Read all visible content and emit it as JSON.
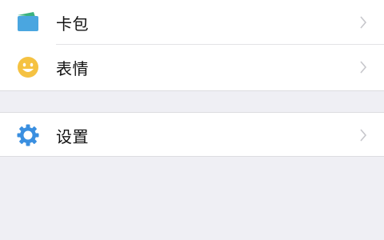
{
  "menu": {
    "items": [
      {
        "label": "卡包",
        "icon": "card-wallet-icon"
      },
      {
        "label": "表情",
        "icon": "emoji-smile-icon"
      }
    ],
    "settings": {
      "label": "设置",
      "icon": "gear-icon"
    }
  },
  "colors": {
    "background": "#efeff4",
    "card_icon": "#4aa6e0",
    "card_tab": "#3bb27f",
    "emoji_icon": "#f5c242",
    "gear_icon": "#3a8fe0",
    "chevron": "#c7c7cc"
  }
}
